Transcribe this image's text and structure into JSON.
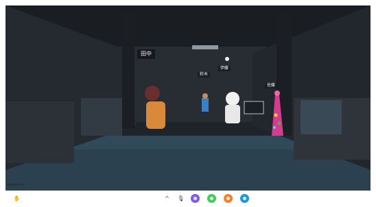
{
  "scene": {
    "avatars": [
      {
        "id": "tanaka",
        "name": "田中"
      },
      {
        "id": "ito",
        "name": "伊藤"
      },
      {
        "id": "small1",
        "name": "鈴木"
      },
      {
        "id": "small2",
        "name": "佐藤"
      }
    ],
    "watermark": "cluster.mu"
  },
  "toolbar": {
    "left_icon": "hand-icon",
    "buttons": [
      {
        "icon": "chevron-up-icon",
        "color": "#444444"
      },
      {
        "icon": "microphone-icon",
        "color": "#333333"
      },
      {
        "icon": "menu-icon",
        "color": "#7d5cf0"
      },
      {
        "icon": "emoji-icon",
        "color": "#3ecf5a"
      },
      {
        "icon": "reaction-icon",
        "color": "#f5822a"
      },
      {
        "icon": "chat-icon",
        "color": "#1a9ad6"
      }
    ]
  }
}
